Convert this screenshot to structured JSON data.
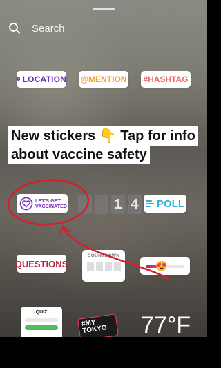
{
  "search": {
    "placeholder": "Search"
  },
  "stickers": {
    "location": "LOCATION",
    "mention": "@MENTION",
    "hashtag": "#HASHTAG",
    "vaccine_line1": "LET'S GET",
    "vaccine_line2": "VACCINATED",
    "timer_digits": [
      "",
      "",
      "1",
      "4"
    ],
    "poll": "POLL",
    "questions": "QUESTIONS",
    "countdown": "COUNTDOWN",
    "quiz": "QUIZ",
    "tokyo_line1": "#MY",
    "tokyo_line2": "TOKYO",
    "temperature": "77°F"
  },
  "caption": {
    "line1": "New stickers 👇 Tap for info",
    "line2": "about vaccine safety"
  },
  "colors": {
    "location_purple": "#6a2bc7",
    "mention_orange": "#f2a233",
    "hashtag_red": "#ef6a6a",
    "poll_blue": "#31b0d9",
    "questions_red": "#b0263f",
    "annotation_red": "#d4202a"
  },
  "icons": {
    "search": "search-icon",
    "location": "location-pin-icon",
    "vaccine": "heart-badge-icon",
    "poll": "poll-bars-icon"
  },
  "slider_level": 0.35
}
